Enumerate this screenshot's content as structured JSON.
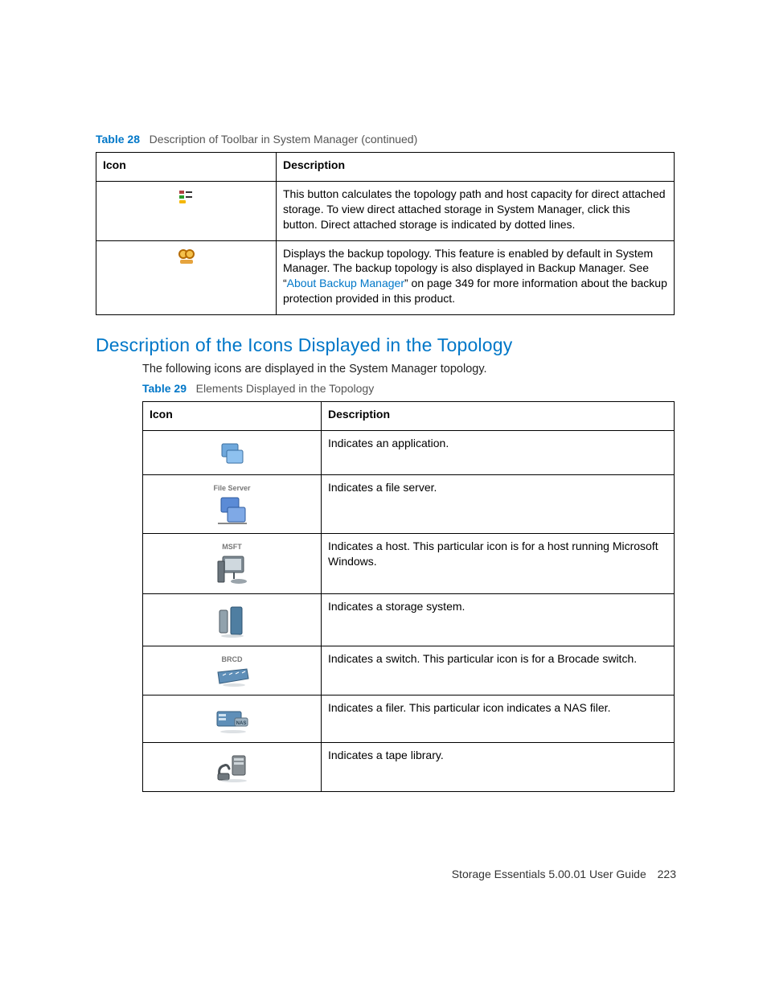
{
  "table28": {
    "caption_label": "Table 28",
    "caption_title": "Description of Toolbar in System Manager (continued)",
    "headers": {
      "icon": "Icon",
      "desc": "Description"
    },
    "rows": [
      {
        "desc": "This button calculates the topology path and host capacity for direct attached storage. To view direct attached storage in System Manager, click this button. Direct attached storage is indicated by dotted lines."
      },
      {
        "desc_before": "Displays the backup topology. This feature is enabled by default in System Manager. The backup topology is also displayed in Backup Manager. See “",
        "desc_link": "About Backup Manager",
        "desc_after": "” on page 349 for more information about the backup protection provided in this product."
      }
    ]
  },
  "section": {
    "heading": "Description of the Icons Displayed in the Topology",
    "intro": "The following icons are displayed in the System Manager topology."
  },
  "table29": {
    "caption_label": "Table 29",
    "caption_title": "Elements Displayed in the Topology",
    "headers": {
      "icon": "Icon",
      "desc": "Description"
    },
    "rows": [
      {
        "icon_label": "",
        "desc": "Indicates an application."
      },
      {
        "icon_label": "File Server",
        "desc": "Indicates a file server."
      },
      {
        "icon_label": "MSFT",
        "desc": "Indicates a host. This particular icon is for a host running Microsoft Windows."
      },
      {
        "icon_label": "",
        "desc": "Indicates a storage system."
      },
      {
        "icon_label": "BRCD",
        "desc": "Indicates a switch. This particular icon is for a Brocade switch."
      },
      {
        "icon_label": "",
        "desc": "Indicates a filer. This particular icon indicates a NAS filer."
      },
      {
        "icon_label": "",
        "desc": "Indicates a tape library."
      }
    ]
  },
  "footer": {
    "text": "Storage Essentials 5.00.01 User Guide",
    "page": "223"
  }
}
